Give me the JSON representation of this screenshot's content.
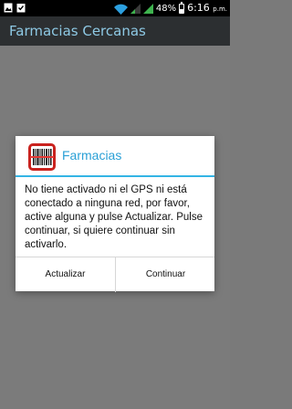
{
  "status_bar": {
    "battery_percent": "48%",
    "time": "6:16",
    "ampm": "p.m.",
    "icons": [
      "image-icon",
      "clipboard-icon",
      "wifi-icon",
      "signal-icon",
      "signal-icon-2",
      "battery-icon"
    ]
  },
  "action_bar": {
    "title": "Farmacias Cercanas"
  },
  "dialog": {
    "title": "Farmacias",
    "message": "No tiene activado ni el GPS ni está conectado a ninguna red, por favor, active alguna y pulse Actualizar. Pulse continuar, si quiere continuar sin activarlo.",
    "buttons": {
      "update": "Actualizar",
      "continue": "Continuar"
    },
    "accent_color": "#34b5e5"
  }
}
